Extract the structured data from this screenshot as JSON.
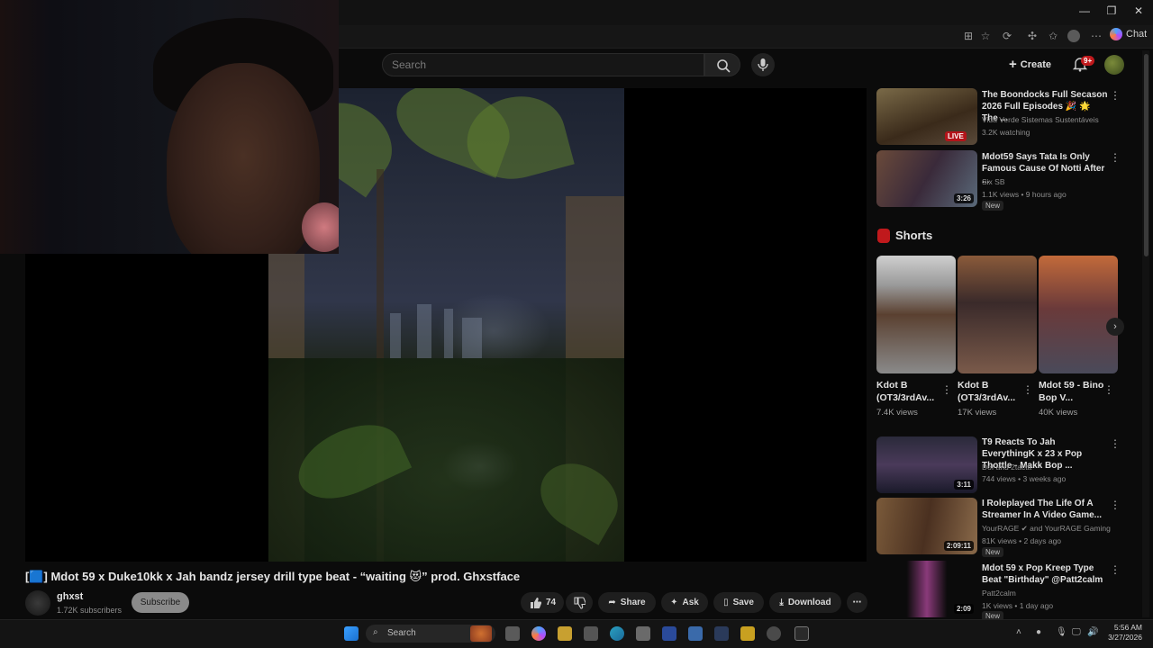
{
  "browser": {
    "window_controls": {
      "minimize": "—",
      "maximize": "❐",
      "close": "✕"
    },
    "chat_label": "Chat"
  },
  "youtube_header": {
    "search_placeholder": "Search",
    "create_label": "Create",
    "notification_count": "9+"
  },
  "video": {
    "title": "[🟦] Mdot 59 x Duke10kk x Jah bandz jersey drill type beat - “waiting 😻” prod. Ghxstface",
    "channel": "ghxst",
    "subscribers": "1.72K subscribers",
    "subscribe_label": "Subscribe",
    "likes": "74",
    "share_label": "Share",
    "ask_label": "Ask",
    "save_label": "Save",
    "download_label": "Download"
  },
  "sidebar": {
    "top_videos": [
      {
        "title": "The Boondocks Full Secason 2026 Full Episodes 🎉 🌟 The ...",
        "channel": "Vida Verde Sistemas Sustentáveis",
        "meta": "3.2K watching",
        "badge": "LIVE"
      },
      {
        "title": "Mdot59 Says Tata Is Only Famous Cause Of Notti After ...",
        "channel": "Six SB",
        "meta": "1.1K views • 9 hours ago",
        "duration": "3:26",
        "new_label": "New"
      }
    ],
    "shorts_heading": "Shorts",
    "shorts": [
      {
        "title": "Kdot B (OT3/3rdAv...",
        "views": "7.4K views"
      },
      {
        "title": "Kdot B (OT3/3rdAv...",
        "views": "17K views"
      },
      {
        "title": "Mdot 59 - Bino Bop V...",
        "views": "40K views"
      }
    ],
    "more_videos": [
      {
        "title": "T9 Reacts To Jah EverythingK x 23 x Pop Thottle - Makk Bop ...",
        "channel": "Dof and 2tacttt",
        "meta": "744 views • 3 weeks ago",
        "duration": "3:11"
      },
      {
        "title": "I Roleplayed The Life Of A Streamer In A Video Game...",
        "channel": "YourRAGE ✔ and YourRAGE Gaming",
        "meta": "81K views • 2 days ago",
        "duration": "2:09:11",
        "new_label": "New"
      },
      {
        "title": "Mdot 59 x Pop Kreep Type Beat \"Birthday\" @Patt2calm",
        "channel": "Patt2calm",
        "meta": "1K views • 1 day ago",
        "duration": "2:09",
        "new_label": "New"
      }
    ]
  },
  "taskbar": {
    "search_label": "Search",
    "time": "5:56 AM",
    "date": "3/27/2026"
  },
  "colors": {
    "accent_red": "#c0191c",
    "background": "#0b0b0b"
  }
}
